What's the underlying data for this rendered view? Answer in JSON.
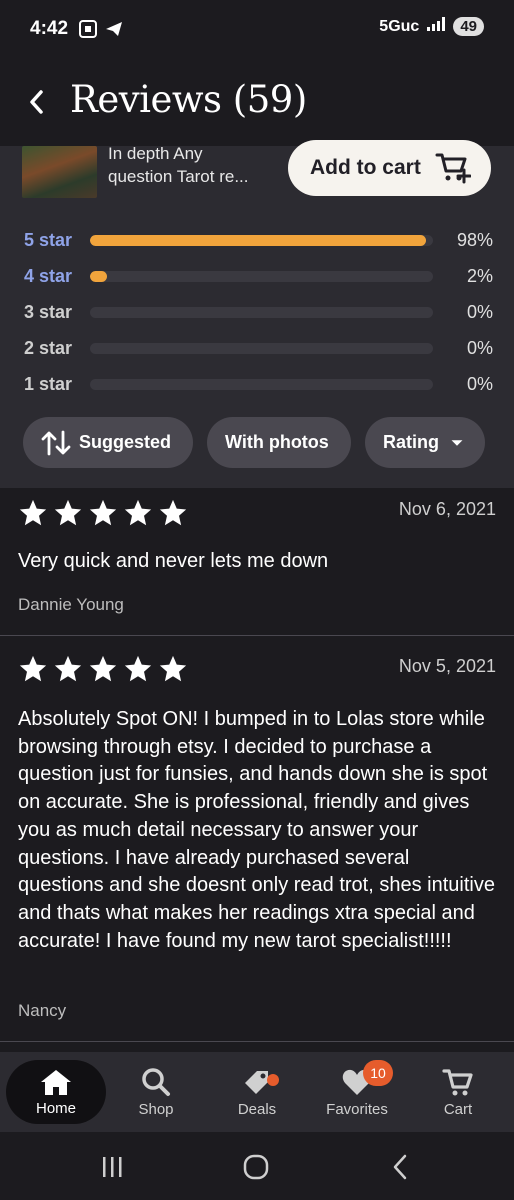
{
  "status_bar": {
    "time": "4:42",
    "network": "5Guc",
    "battery": "49"
  },
  "header": {
    "title": "Reviews (59)"
  },
  "product": {
    "name_line1": "In depth Any",
    "name_line2": "question Tarot re...",
    "add_to_cart": "Add to cart"
  },
  "rating_breakdown": [
    {
      "label": "5 star",
      "percent_text": "98%",
      "fraction": 0.98
    },
    {
      "label": "4 star",
      "percent_text": "2%",
      "fraction": 0.05
    },
    {
      "label": "3 star",
      "percent_text": "0%",
      "fraction": 0
    },
    {
      "label": "2 star",
      "percent_text": "0%",
      "fraction": 0
    },
    {
      "label": "1 star",
      "percent_text": "0%",
      "fraction": 0
    }
  ],
  "filters": {
    "suggested": "Suggested",
    "with_photos": "With photos",
    "rating": "Rating"
  },
  "reviews": [
    {
      "stars": 5,
      "date": "Nov 6, 2021",
      "text": "Very quick and never lets me down",
      "author": "Dannie Young"
    },
    {
      "stars": 5,
      "date": "Nov 5, 2021",
      "text": "Absolutely Spot ON! I bumped in to Lolas store while browsing through etsy. I decided to purchase a question just for funsies, and hands down she is spot on accurate. She is professional, friendly and gives you as much detail necessary to answer your questions. I have already purchased several questions and she doesnt only read trot, shes intuitive and thats what makes her readings xtra special and accurate! I have found my new tarot specialist!!!!!",
      "author": "Nancy"
    }
  ],
  "bottom_nav": {
    "home": "Home",
    "shop": "Shop",
    "deals": "Deals",
    "favorites": "Favorites",
    "favorites_badge": "10",
    "cart": "Cart"
  },
  "colors": {
    "accent_bar": "#f1a43c",
    "badge": "#e65c2c",
    "link_blue": "#8fa3e8"
  }
}
